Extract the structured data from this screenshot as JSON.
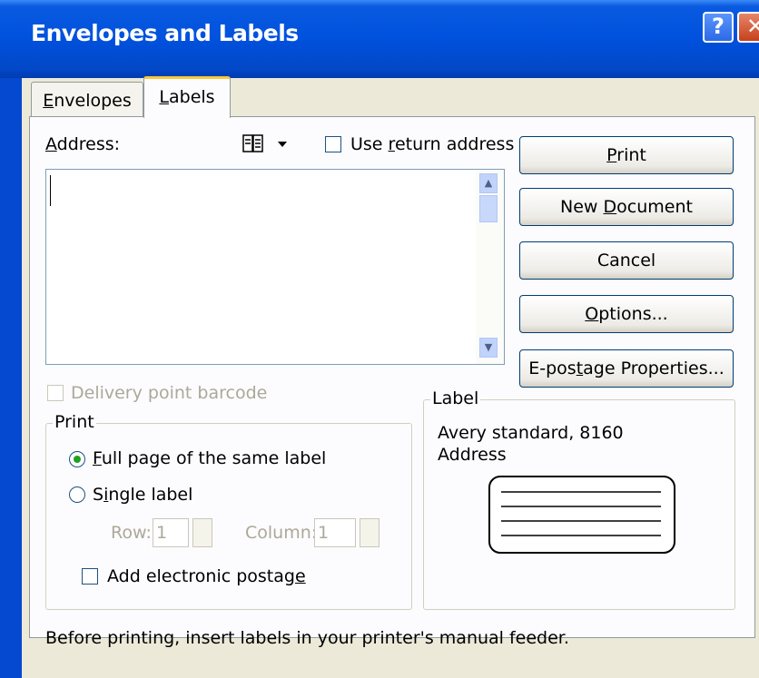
{
  "window": {
    "title": "Envelopes and Labels",
    "help_glyph": "?",
    "close_glyph": "✕"
  },
  "tabs": [
    {
      "label": "Envelopes",
      "active": false
    },
    {
      "label": "Labels",
      "active": true
    }
  ],
  "address": {
    "label": "Address:",
    "value": "",
    "use_return_address_label": "Use return address",
    "use_return_address_checked": false,
    "book_icon": "address-book-icon"
  },
  "buttons": {
    "print": "Print",
    "new_document": "New Document",
    "cancel": "Cancel",
    "options": "Options...",
    "epostage_properties": "E-postage Properties..."
  },
  "delivery_point_barcode": {
    "label": "Delivery point barcode",
    "checked": false,
    "enabled": false
  },
  "print_group": {
    "legend": "Print",
    "full_page_label": "Full page of the same label",
    "single_label": "Single label",
    "selected": "full_page",
    "row_label": "Row:",
    "row_value": "1",
    "column_label": "Column:",
    "column_value": "1",
    "add_postage_label": "Add electronic postage",
    "add_postage_checked": false
  },
  "label_group": {
    "legend": "Label",
    "product": "Avery standard, 8160",
    "type": "Address"
  },
  "status_text": "Before printing, insert labels in your printer's manual feeder."
}
